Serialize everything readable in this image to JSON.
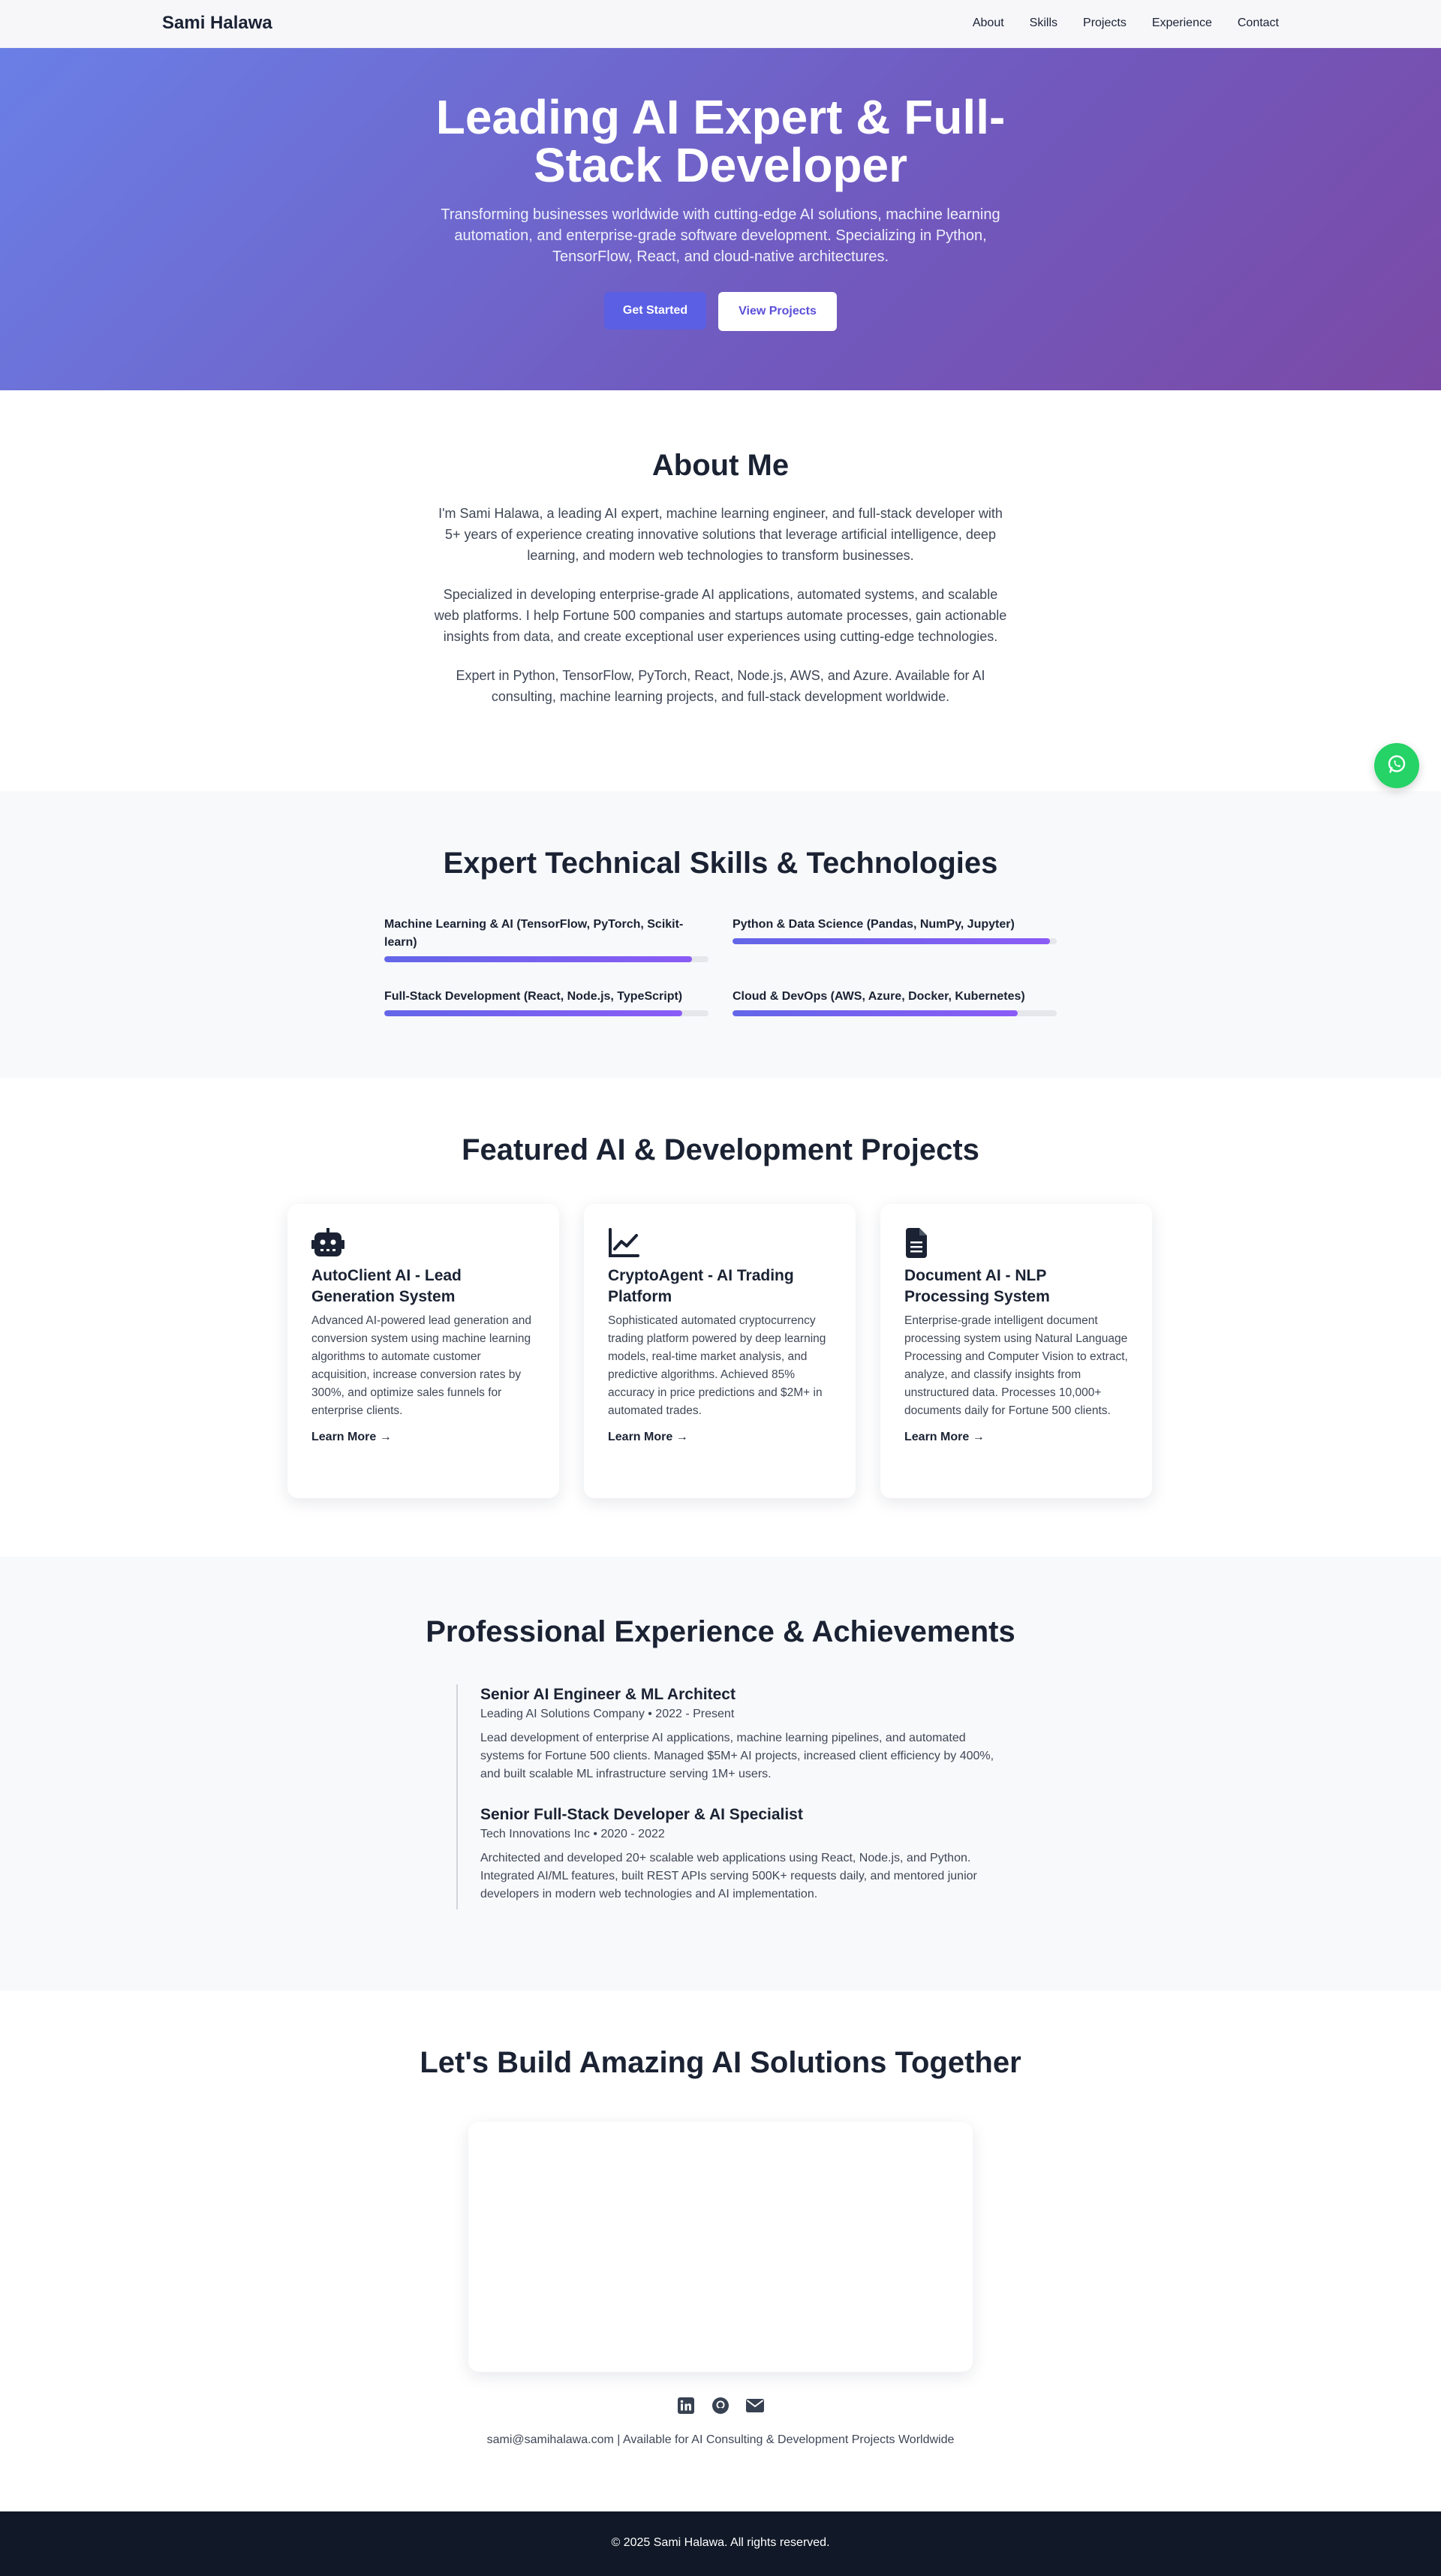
{
  "nav": {
    "brand": "Sami Halawa",
    "links": [
      "About",
      "Skills",
      "Projects",
      "Experience",
      "Contact"
    ]
  },
  "hero": {
    "title": "Leading AI Expert & Full-Stack Developer",
    "subtitle": "Transforming businesses worldwide with cutting-edge AI solutions, machine learning automation, and enterprise-grade software development. Specializing in Python, TensorFlow, React, and cloud-native architectures.",
    "primary_button": "Get Started",
    "secondary_button": "View Projects"
  },
  "about": {
    "title": "About Me",
    "paragraphs": [
      "I'm Sami Halawa, a leading AI expert, machine learning engineer, and full-stack developer with 5+ years of experience creating innovative solutions that leverage artificial intelligence, deep learning, and modern web technologies to transform businesses.",
      "Specialized in developing enterprise-grade AI applications, automated systems, and scalable web platforms. I help Fortune 500 companies and startups automate processes, gain actionable insights from data, and create exceptional user experiences using cutting-edge technologies.",
      "Expert in Python, TensorFlow, PyTorch, React, Node.js, AWS, and Azure. Available for AI consulting, machine learning projects, and full-stack development worldwide."
    ]
  },
  "skills": {
    "title": "Expert Technical Skills & Technologies",
    "items": [
      {
        "label": "Machine Learning & AI (TensorFlow, PyTorch, Scikit-learn)",
        "level": 0.95
      },
      {
        "label": "Python & Data Science (Pandas, NumPy, Jupyter)",
        "level": 0.98
      },
      {
        "label": "Full-Stack Development (React, Node.js, TypeScript)",
        "level": 0.92
      },
      {
        "label": "Cloud & DevOps (AWS, Azure, Docker, Kubernetes)",
        "level": 0.88
      }
    ]
  },
  "projects": {
    "title": "Featured AI & Development Projects",
    "cards": [
      {
        "icon": "robot-icon",
        "title": "AutoClient AI - Lead Generation System",
        "description": "Advanced AI-powered lead generation and conversion system using machine learning algorithms to automate customer acquisition, increase conversion rates by 300%, and optimize sales funnels for enterprise clients.",
        "link": "Learn More →"
      },
      {
        "icon": "chart-line-icon",
        "title": "CryptoAgent - AI Trading Platform",
        "description": "Sophisticated automated cryptocurrency trading platform powered by deep learning models, real-time market analysis, and predictive algorithms. Achieved 85% accuracy in price predictions and $2M+ in automated trades.",
        "link": "Learn More →"
      },
      {
        "icon": "document-icon",
        "title": "Document AI - NLP Processing System",
        "description": "Enterprise-grade intelligent document processing system using Natural Language Processing and Computer Vision to extract, analyze, and classify insights from unstructured data. Processes 10,000+ documents daily for Fortune 500 clients.",
        "link": "Learn More →"
      }
    ]
  },
  "experience": {
    "title": "Professional Experience & Achievements",
    "jobs": [
      {
        "title": "Senior AI Engineer & ML Architect",
        "meta": "Leading AI Solutions Company • 2022 - Present",
        "description": "Lead development of enterprise AI applications, machine learning pipelines, and automated systems for Fortune 500 clients. Managed $5M+ AI projects, increased client efficiency by 400%, and built scalable ML infrastructure serving 1M+ users."
      },
      {
        "title": "Senior Full-Stack Developer & AI Specialist",
        "meta": "Tech Innovations Inc • 2020 - 2022",
        "description": "Architected and developed 20+ scalable web applications using React, Node.js, and Python. Integrated AI/ML features, built REST APIs serving 500K+ requests daily, and mentored junior developers in modern web technologies and AI implementation."
      }
    ]
  },
  "contact": {
    "title": "Let's Build Amazing AI Solutions Together",
    "socials": [
      "linkedin-icon",
      "github-icon",
      "email-icon"
    ],
    "line": "sami@samihalawa.com | Available for AI Consulting & Development Projects Worldwide"
  },
  "footer": {
    "text": "© 2025 Sami Halawa. All rights reserved."
  },
  "colors": {
    "hero_gradient_start": "#6a7fe6",
    "hero_gradient_end": "#7b4aa6",
    "primary_button": "#5b5fe4",
    "skill_bar": "#7c5cf0",
    "whatsapp": "#25d366",
    "footer": "#111827"
  }
}
